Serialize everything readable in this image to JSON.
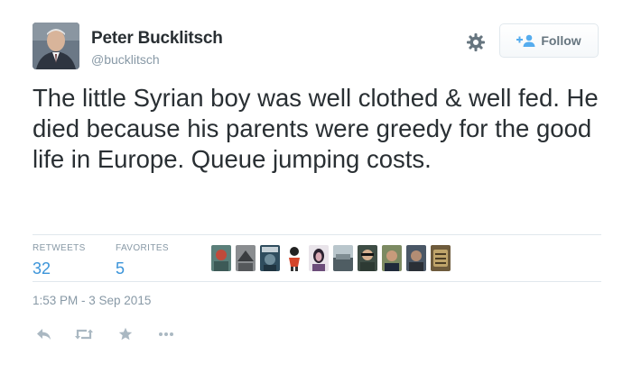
{
  "user": {
    "name": "Peter Bucklitsch",
    "handle": "@bucklitsch"
  },
  "follow_button": {
    "label": "Follow",
    "icon": "add-user-icon"
  },
  "settings_icon": "gear-icon",
  "tweet": {
    "text": "The little Syrian boy was well clothed & well fed. He died because his parents were greedy for the good life in Europe. Queue jumping costs."
  },
  "stats": {
    "retweets_label": "RETWEETS",
    "retweets_count": "32",
    "favorites_label": "FAVORITES",
    "favorites_count": "5"
  },
  "favoriters_shown": 10,
  "timestamp": "1:53 PM - 3 Sep 2015",
  "actions": [
    "reply-icon",
    "retweet-icon",
    "favorite-icon",
    "more-icon"
  ],
  "colors": {
    "name_text": "#292f33",
    "meta_text": "#8899a6",
    "count_blue": "#3b94d9",
    "follow_icon_blue": "#55acee",
    "action_gray": "#aab8c2",
    "divider": "#e1e8ed"
  }
}
